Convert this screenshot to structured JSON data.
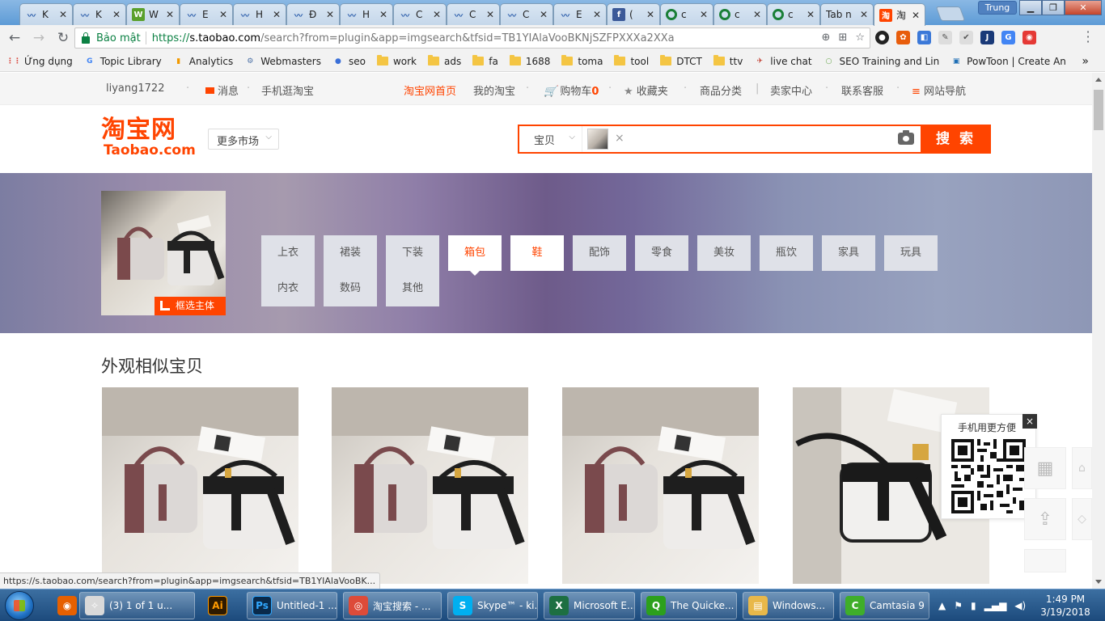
{
  "browser": {
    "tabs": [
      {
        "title": "K",
        "icon": "wave-icon",
        "color": "#2a5caa"
      },
      {
        "title": "K",
        "icon": "wave-icon",
        "color": "#2a5caa"
      },
      {
        "title": "W",
        "icon": "w-icon",
        "color": "#5aa02c"
      },
      {
        "title": "E",
        "icon": "wave-icon",
        "color": "#2a5caa"
      },
      {
        "title": "H",
        "icon": "wave-icon",
        "color": "#2a5caa"
      },
      {
        "title": "Đ",
        "icon": "wave-icon",
        "color": "#2a5caa"
      },
      {
        "title": "H",
        "icon": "wave-icon",
        "color": "#2a5caa"
      },
      {
        "title": "C",
        "icon": "wave-icon",
        "color": "#2a5caa"
      },
      {
        "title": "C",
        "icon": "wave-icon",
        "color": "#2a5caa"
      },
      {
        "title": "C",
        "icon": "wave-icon",
        "color": "#2a5caa"
      },
      {
        "title": "E",
        "icon": "wave-icon",
        "color": "#2a5caa"
      },
      {
        "title": "(",
        "icon": "facebook-icon",
        "color": "#3b5998"
      },
      {
        "title": "c",
        "icon": "ring-icon",
        "color": "#1a7f37"
      },
      {
        "title": "c",
        "icon": "ring-icon",
        "color": "#1a7f37"
      },
      {
        "title": "c",
        "icon": "ring-icon",
        "color": "#1a7f37"
      },
      {
        "title": "Tab n",
        "icon": "none",
        "color": ""
      },
      {
        "title": "淘",
        "icon": "taobao-icon",
        "color": "#f40",
        "active": true
      }
    ],
    "profile_name": "Trung",
    "address": {
      "secure_label": "Bảo mật",
      "scheme": "https://",
      "host": "s.taobao.com",
      "path": "/search?from=plugin&app=imgsearch&tfsid=TB1YIAlaVooBKNjSZFPXXXa2XXa"
    },
    "bookmarks": [
      {
        "label": "Ứng dụng",
        "icon": "apps-grid-icon"
      },
      {
        "label": "Topic Library",
        "icon": "google-icon"
      },
      {
        "label": "Analytics",
        "icon": "analytics-icon"
      },
      {
        "label": "Webmasters",
        "icon": "webmasters-icon"
      },
      {
        "label": "seo",
        "icon": "seo-icon"
      },
      {
        "label": "work",
        "icon": "folder-icon"
      },
      {
        "label": "ads",
        "icon": "folder-icon"
      },
      {
        "label": "fa",
        "icon": "folder-icon"
      },
      {
        "label": "1688",
        "icon": "folder-icon"
      },
      {
        "label": "toma",
        "icon": "folder-icon"
      },
      {
        "label": "tool",
        "icon": "folder-icon"
      },
      {
        "label": "DTCT",
        "icon": "folder-icon"
      },
      {
        "label": "ttv",
        "icon": "folder-icon"
      },
      {
        "label": "live chat",
        "icon": "livechat-icon"
      },
      {
        "label": "SEO Training and Lin",
        "icon": "seo-training-icon"
      },
      {
        "label": "PowToon | Create An",
        "icon": "powtoon-icon"
      }
    ],
    "status_url": "https://s.taobao.com/search?from=plugin&app=imgsearch&tfsid=TB1YIAlaVooBK..."
  },
  "site": {
    "top_nav": {
      "username": "liyang1722",
      "messages": "消息",
      "mobile": "手机逛淘宝",
      "home": "淘宝网首页",
      "my_taobao": "我的淘宝",
      "cart": "购物车",
      "cart_count": "0",
      "favorites": "收藏夹",
      "categories": "商品分类",
      "seller_center": "卖家中心",
      "support": "联系客服",
      "site_nav": "网站导航"
    },
    "logo_cn": "淘宝网",
    "logo_en": "Taobao.com",
    "more_market": "更多市场",
    "search": {
      "type": "宝贝",
      "button": "搜 索"
    },
    "crop_label": "框选主体",
    "categories_row1": [
      "上衣",
      "裙装",
      "下装",
      "箱包",
      "鞋",
      "配饰",
      "零食",
      "美妆",
      "瓶饮",
      "家具",
      "玩具"
    ],
    "categories_row2": [
      "内衣",
      "数码",
      "其他"
    ],
    "selected_category": "箱包",
    "section_title": "外观相似宝贝",
    "qr_title": "手机用更方便",
    "qr_close": "×"
  },
  "taskbar": {
    "items": [
      {
        "label": "",
        "icon": "firefox-icon",
        "pinned": true
      },
      {
        "label": "(3) 1 of 1 u...",
        "icon": "badminton-icon"
      },
      {
        "label": "",
        "icon": "illustrator-icon",
        "pinned": true
      },
      {
        "label": "Untitled-1 ...",
        "icon": "photoshop-icon"
      },
      {
        "label": "淘宝搜索 - ...",
        "icon": "chrome-icon"
      },
      {
        "label": "Skype™ - ki...",
        "icon": "skype-icon"
      },
      {
        "label": "Microsoft E...",
        "icon": "excel-icon"
      },
      {
        "label": "The Quicke...",
        "icon": "quickbooks-icon"
      },
      {
        "label": "Windows...",
        "icon": "explorer-icon"
      },
      {
        "label": "Camtasia 9",
        "icon": "camtasia-icon"
      }
    ],
    "time": "1:49 PM",
    "date": "3/19/2018"
  }
}
